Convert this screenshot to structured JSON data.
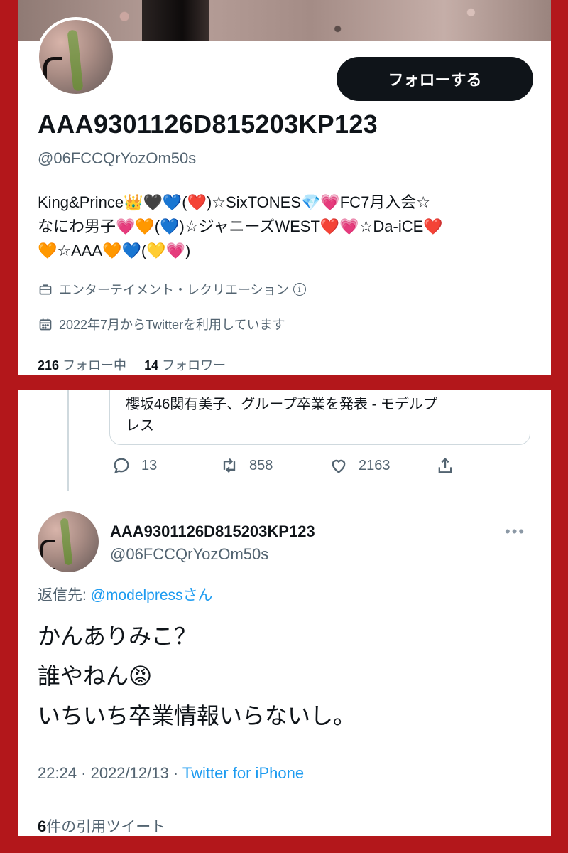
{
  "profile": {
    "follow_label": "フォローする",
    "display_name": "AAA9301126D815203KP123",
    "handle": "@06FCCQrYozOm50s",
    "bio_lines": [
      "King&Prince👑🖤💙(❤️)☆SixTONES💎💗FC7月入会☆",
      "なにわ男子💗🧡(💙)☆ジャニーズWEST❤️💗☆Da-iCE❤️",
      "🧡☆AAA🧡💙(💛💗)"
    ],
    "category": "エンターテイメント・レクリエーション",
    "category_icon": "briefcase-icon",
    "joined": "2022年7月からTwitterを利用しています",
    "joined_icon": "calendar-icon",
    "following_count": "216",
    "following_label": "フォロー中",
    "followers_count": "14",
    "followers_label": "フォロワー"
  },
  "quoted_card": {
    "lines": [
      "櫻坂46関有美子、グループ卒業を発表 - モデルプ",
      "レス"
    ]
  },
  "tweet_actions": {
    "replies": "13",
    "retweets": "858",
    "likes": "2163"
  },
  "reply_tweet": {
    "display_name": "AAA9301126D815203KP123",
    "handle": "@06FCCQrYozOm50s",
    "more_label": "•••",
    "reply_to_prefix": "返信先: ",
    "reply_to_handle": "@modelpress",
    "reply_to_suffix": "さん",
    "text_lines": [
      "かんありみこ？",
      "誰やねん😡",
      "いちいち卒業情報いらないし。"
    ],
    "timestamp": "22:24 · 2022/12/13 · ",
    "source": "Twitter for iPhone",
    "quote_count": "6",
    "quote_label": "件の引用ツイート"
  },
  "colors": {
    "frame": "#b3171b",
    "link": "#1d9bf0",
    "muted": "#536471",
    "text": "#0f1419"
  }
}
